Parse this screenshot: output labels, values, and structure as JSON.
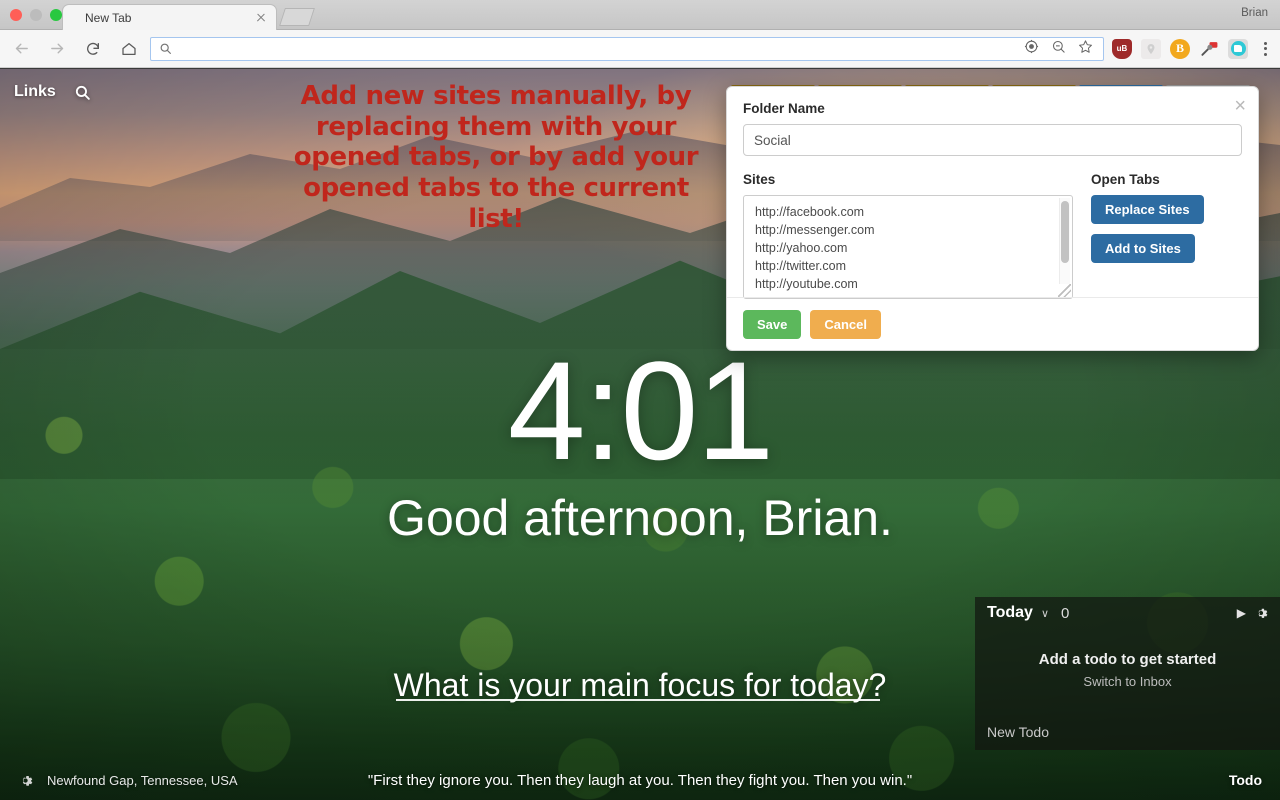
{
  "browser": {
    "tab_title": "New Tab",
    "profile_name": "Brian",
    "address_value": "",
    "address_placeholder": "",
    "nav": {
      "back": "back-arrow",
      "forward": "forward-arrow",
      "reload": "reload",
      "home": "home"
    },
    "omnibox_icons": [
      "location-target-icon",
      "zoom-icon",
      "bookmark-star-icon"
    ],
    "extensions": [
      {
        "name": "ublock-origin",
        "label": "uB",
        "color": "#9e2a2a"
      },
      {
        "name": "location-pin",
        "label": "",
        "color": "#eceaea"
      },
      {
        "name": "brave-rewards",
        "label": "B",
        "color": "#f2a81d"
      },
      {
        "name": "password-manager",
        "label": "",
        "color": "#ffffff"
      },
      {
        "name": "momentum",
        "label": "",
        "color": "#2ec9d6"
      }
    ]
  },
  "newtab": {
    "links_label": "Links",
    "clock": "4:01",
    "greeting": "Good afternoon, Brian.",
    "focus_question": "What is your main focus for today?",
    "focus_value": "",
    "location": "Newfound Gap, Tennessee, USA",
    "quote": "\"First they ignore you. Then they laugh at you. Then they fight you. Then you win.\"",
    "todo_link": "Todo",
    "tiles": [
      {
        "name": "tile-1",
        "color": "#8a6a12"
      },
      {
        "name": "tile-2",
        "color": "#8a6a12"
      },
      {
        "name": "tile-3",
        "color": "#8a6a12"
      },
      {
        "name": "tile-4",
        "color": "#8a6a12"
      },
      {
        "name": "tile-5",
        "color": "#8a6a12"
      },
      {
        "name": "tile-6",
        "color": "#9a9a9a"
      }
    ]
  },
  "todo": {
    "title": "Today",
    "count": "0",
    "empty_message": "Add a todo to get started",
    "switch_label": "Switch to Inbox",
    "new_todo_label": "New Todo",
    "caret": "∨",
    "play": "▶"
  },
  "annotation": {
    "text": "Add new sites manually, by replacing them with your opened tabs, or by add your opened tabs to the current list!",
    "color": "#c0261c"
  },
  "modal": {
    "folder_name_label": "Folder Name",
    "folder_name_value": "Social",
    "folder_name_placeholder": "Folder Name",
    "sites_label": "Sites",
    "sites": [
      "http://facebook.com",
      "http://messenger.com",
      "http://yahoo.com",
      "http://twitter.com",
      "http://youtube.com"
    ],
    "open_tabs_label": "Open Tabs",
    "replace_sites_label": "Replace Sites",
    "add_to_sites_label": "Add to Sites",
    "save_label": "Save",
    "cancel_label": "Cancel",
    "close_label": "×",
    "colors": {
      "primary": "#2d6ca2",
      "save": "#5cb85c",
      "cancel": "#f0ad4e"
    }
  }
}
